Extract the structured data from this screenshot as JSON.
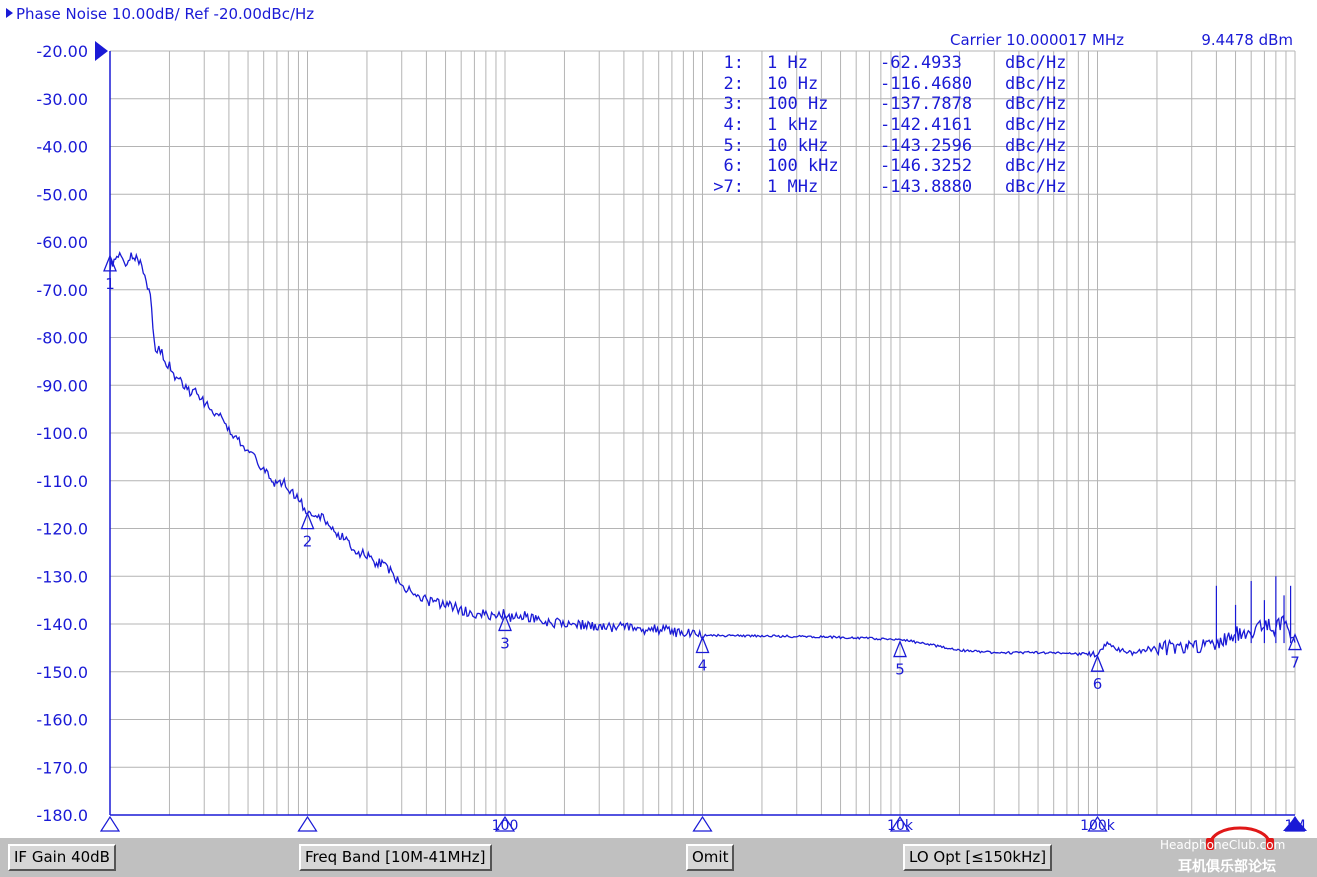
{
  "header": {
    "title": "Phase Noise 10.00dB/ Ref -20.00dBc/Hz"
  },
  "carrier": {
    "label": "Carrier 10.000017 MHz",
    "power": "9.4478 dBm"
  },
  "markers_table": [
    {
      "idx": "1:",
      "freq": "1 Hz",
      "value": "-62.4933",
      "unit": "dBc/Hz"
    },
    {
      "idx": "2:",
      "freq": "10 Hz",
      "value": "-116.4680",
      "unit": "dBc/Hz"
    },
    {
      "idx": "3:",
      "freq": "100 Hz",
      "value": "-137.7878",
      "unit": "dBc/Hz"
    },
    {
      "idx": "4:",
      "freq": "1 kHz",
      "value": "-142.4161",
      "unit": "dBc/Hz"
    },
    {
      "idx": "5:",
      "freq": "10 kHz",
      "value": "-143.2596",
      "unit": "dBc/Hz"
    },
    {
      "idx": "6:",
      "freq": "100 kHz",
      "value": "-146.3252",
      "unit": "dBc/Hz"
    },
    {
      "idx": ">7:",
      "freq": "1 MHz",
      "value": "-143.8880",
      "unit": "dBc/Hz"
    }
  ],
  "chart_data": {
    "type": "line",
    "x_scale": "log",
    "xlim": [
      1,
      1000000
    ],
    "ylim": [
      -180,
      -20
    ],
    "y_ticks": [
      "-20.00",
      "-30.00",
      "-40.00",
      "-50.00",
      "-60.00",
      "-70.00",
      "-80.00",
      "-90.00",
      "-100.0",
      "-110.0",
      "-120.0",
      "-130.0",
      "-140.0",
      "-150.0",
      "-160.0",
      "-170.0",
      "-180.0"
    ],
    "x_tick_labels": [
      "",
      "",
      "100",
      "",
      "10k",
      "100k",
      "1M"
    ],
    "grid": true,
    "trace_color": "#1a1ad6",
    "series": [
      {
        "x": [
          1,
          1.1,
          1.2,
          1.3,
          1.4,
          1.5,
          1.6,
          1.7,
          1.8,
          2,
          2.2,
          2.5,
          2.8,
          3,
          3.5,
          4,
          4.5,
          5,
          5.5,
          6,
          6.5,
          7,
          7.5,
          8,
          9,
          10,
          11,
          12,
          13,
          15,
          17,
          20,
          25,
          30,
          35,
          40,
          50,
          60,
          70,
          80,
          90,
          100,
          110,
          120,
          150,
          200,
          300,
          500,
          700,
          1000,
          2000,
          3000,
          5000,
          7000,
          10000,
          15000,
          20000,
          30000,
          40000,
          50000,
          70000,
          100000,
          110000,
          120000,
          150000,
          200000,
          300000,
          400000,
          500000,
          600000,
          700000,
          800000,
          900000,
          1000000
        ],
        "y": [
          -65,
          -62.5,
          -64,
          -63,
          -64,
          -66,
          -72,
          -82,
          -83,
          -86,
          -89,
          -91,
          -92,
          -94,
          -96,
          -99,
          -102,
          -104,
          -106,
          -108,
          -109,
          -111,
          -110,
          -112,
          -114,
          -116.5,
          -117,
          -118,
          -120,
          -122,
          -124,
          -126,
          -128,
          -132,
          -134,
          -135,
          -136,
          -137,
          -138,
          -138,
          -139,
          -137.8,
          -139,
          -138,
          -139.5,
          -140,
          -140.5,
          -141,
          -141.5,
          -142.4,
          -142.5,
          -142.6,
          -142.8,
          -143,
          -143.2,
          -144.5,
          -145.5,
          -146,
          -146,
          -146,
          -146,
          -146.3,
          -144,
          -145,
          -146,
          -145,
          -145,
          -144,
          -142,
          -142,
          -140,
          -141,
          -139,
          -143.9
        ]
      }
    ],
    "markers": [
      {
        "n": "1",
        "x": 1,
        "y": -62.4933
      },
      {
        "n": "2",
        "x": 10,
        "y": -116.468
      },
      {
        "n": "3",
        "x": 100,
        "y": -137.7878
      },
      {
        "n": "4",
        "x": 1000,
        "y": -142.4161
      },
      {
        "n": "5",
        "x": 10000,
        "y": -143.2596
      },
      {
        "n": "6",
        "x": 100000,
        "y": -146.3252
      },
      {
        "n": "7",
        "x": 1000000,
        "y": -143.888
      }
    ]
  },
  "status_bar": {
    "if_gain": "IF Gain 40dB",
    "freq_band": "Freq Band [10M-41MHz]",
    "omit": "Omit",
    "lo_opt": "LO Opt [≤150kHz]"
  },
  "watermark": {
    "site": "HeadphoneClub.com",
    "cn": "耳机俱乐部论坛"
  }
}
